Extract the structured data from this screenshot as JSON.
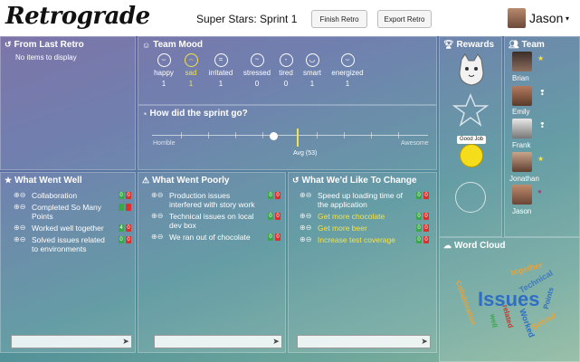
{
  "app": {
    "logo": "Retrograde",
    "sprint_title": "Super Stars: Sprint 1",
    "finish_label": "Finish Retro",
    "export_label": "Export Retro",
    "username": "Jason",
    "caret": "▾"
  },
  "last_retro": {
    "title": "From Last Retro",
    "empty": "No items to display"
  },
  "mood": {
    "title": "Team Mood",
    "items": [
      {
        "label": "happy",
        "count": "1",
        "face": "⌣"
      },
      {
        "label": "sad",
        "count": "1",
        "face": "⌢"
      },
      {
        "label": "irritated",
        "count": "1",
        "face": "="
      },
      {
        "label": "stressed",
        "count": "0",
        "face": "~"
      },
      {
        "label": "tired",
        "count": "0",
        "face": "-"
      },
      {
        "label": "smart",
        "count": "1",
        "face": "◡"
      },
      {
        "label": "energized",
        "count": "1",
        "face": "⌣"
      }
    ],
    "selected": "sad"
  },
  "sprint": {
    "title": "How did the sprint go?",
    "left": "Horrible",
    "right": "Awesome",
    "avg": "Avg (53)",
    "value": 53
  },
  "well": {
    "title": "What Went Well",
    "items": [
      {
        "text": "Collaboration",
        "up": "0",
        "down": "0"
      },
      {
        "text": "Completed So Many Points",
        "up": "",
        "down": ""
      },
      {
        "text": "Worked well together",
        "up": "4",
        "down": "0"
      },
      {
        "text": "Solved issues related to environments",
        "up": "0",
        "down": "0"
      }
    ]
  },
  "poorly": {
    "title": "What Went Poorly",
    "items": [
      {
        "text": "Production issues interfered with story work",
        "up": "0",
        "down": "0"
      },
      {
        "text": "Technical issues on local dev box",
        "up": "0",
        "down": "0"
      },
      {
        "text": "We ran out of chocolate",
        "up": "0",
        "down": "0"
      }
    ]
  },
  "change": {
    "title": "What We'd Like To Change",
    "items": [
      {
        "text": "Speed up loading time of the application",
        "up": "0",
        "down": "0"
      },
      {
        "text": "Get more chocolate",
        "up": "0",
        "down": "0"
      },
      {
        "text": "Get more beer",
        "up": "0",
        "down": "0"
      },
      {
        "text": "Increase test coverage",
        "up": "0",
        "down": "0"
      }
    ]
  },
  "rewards": {
    "title": "Rewards",
    "good_job": "Good Job"
  },
  "team": {
    "title": "Team",
    "members": [
      {
        "name": "Brian",
        "status": "★"
      },
      {
        "name": "Emily",
        "status": "❢"
      },
      {
        "name": "Frank",
        "status": "❢"
      },
      {
        "name": "Jonathan",
        "status": "★"
      },
      {
        "name": "Jason",
        "status": "●"
      }
    ]
  },
  "cloud": {
    "title": "Word Cloud",
    "words": [
      "together",
      "Technical",
      "Issues",
      "Collaboration",
      "Points",
      "Solved",
      "Worked",
      "related",
      "well"
    ]
  },
  "colors": {
    "accent": "#f3e24b",
    "up": "#3aa74a",
    "down": "#d9322d"
  }
}
